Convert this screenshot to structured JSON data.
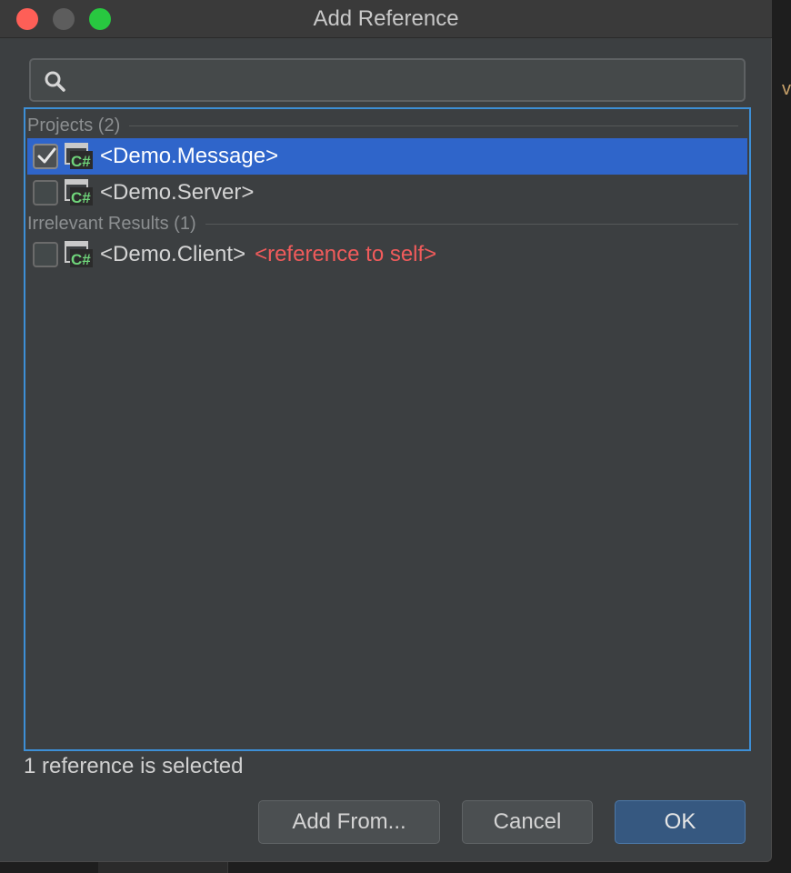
{
  "window": {
    "title": "Add Reference"
  },
  "search": {
    "placeholder": "",
    "value": ""
  },
  "groups": [
    {
      "label": "Projects (2)",
      "items": [
        {
          "label": "<Demo.Message>",
          "checked": true,
          "selected": true,
          "icon": "csharp-project-icon"
        },
        {
          "label": "<Demo.Server>",
          "checked": false,
          "selected": false,
          "icon": "csharp-project-icon"
        }
      ]
    },
    {
      "label": "Irrelevant Results (1)",
      "items": [
        {
          "label": "<Demo.Client>",
          "note": "<reference to self>",
          "checked": false,
          "selected": false,
          "icon": "csharp-project-icon"
        }
      ]
    }
  ],
  "status": "1 reference is selected",
  "buttons": {
    "add_from": "Add From...",
    "cancel": "Cancel",
    "ok": "OK"
  },
  "colors": {
    "dialog_bg": "#3c3f41",
    "selection": "#2f65ca",
    "focus_border": "#3d8fd6",
    "warning_text": "#f05b5b",
    "ok_button": "#365880"
  }
}
